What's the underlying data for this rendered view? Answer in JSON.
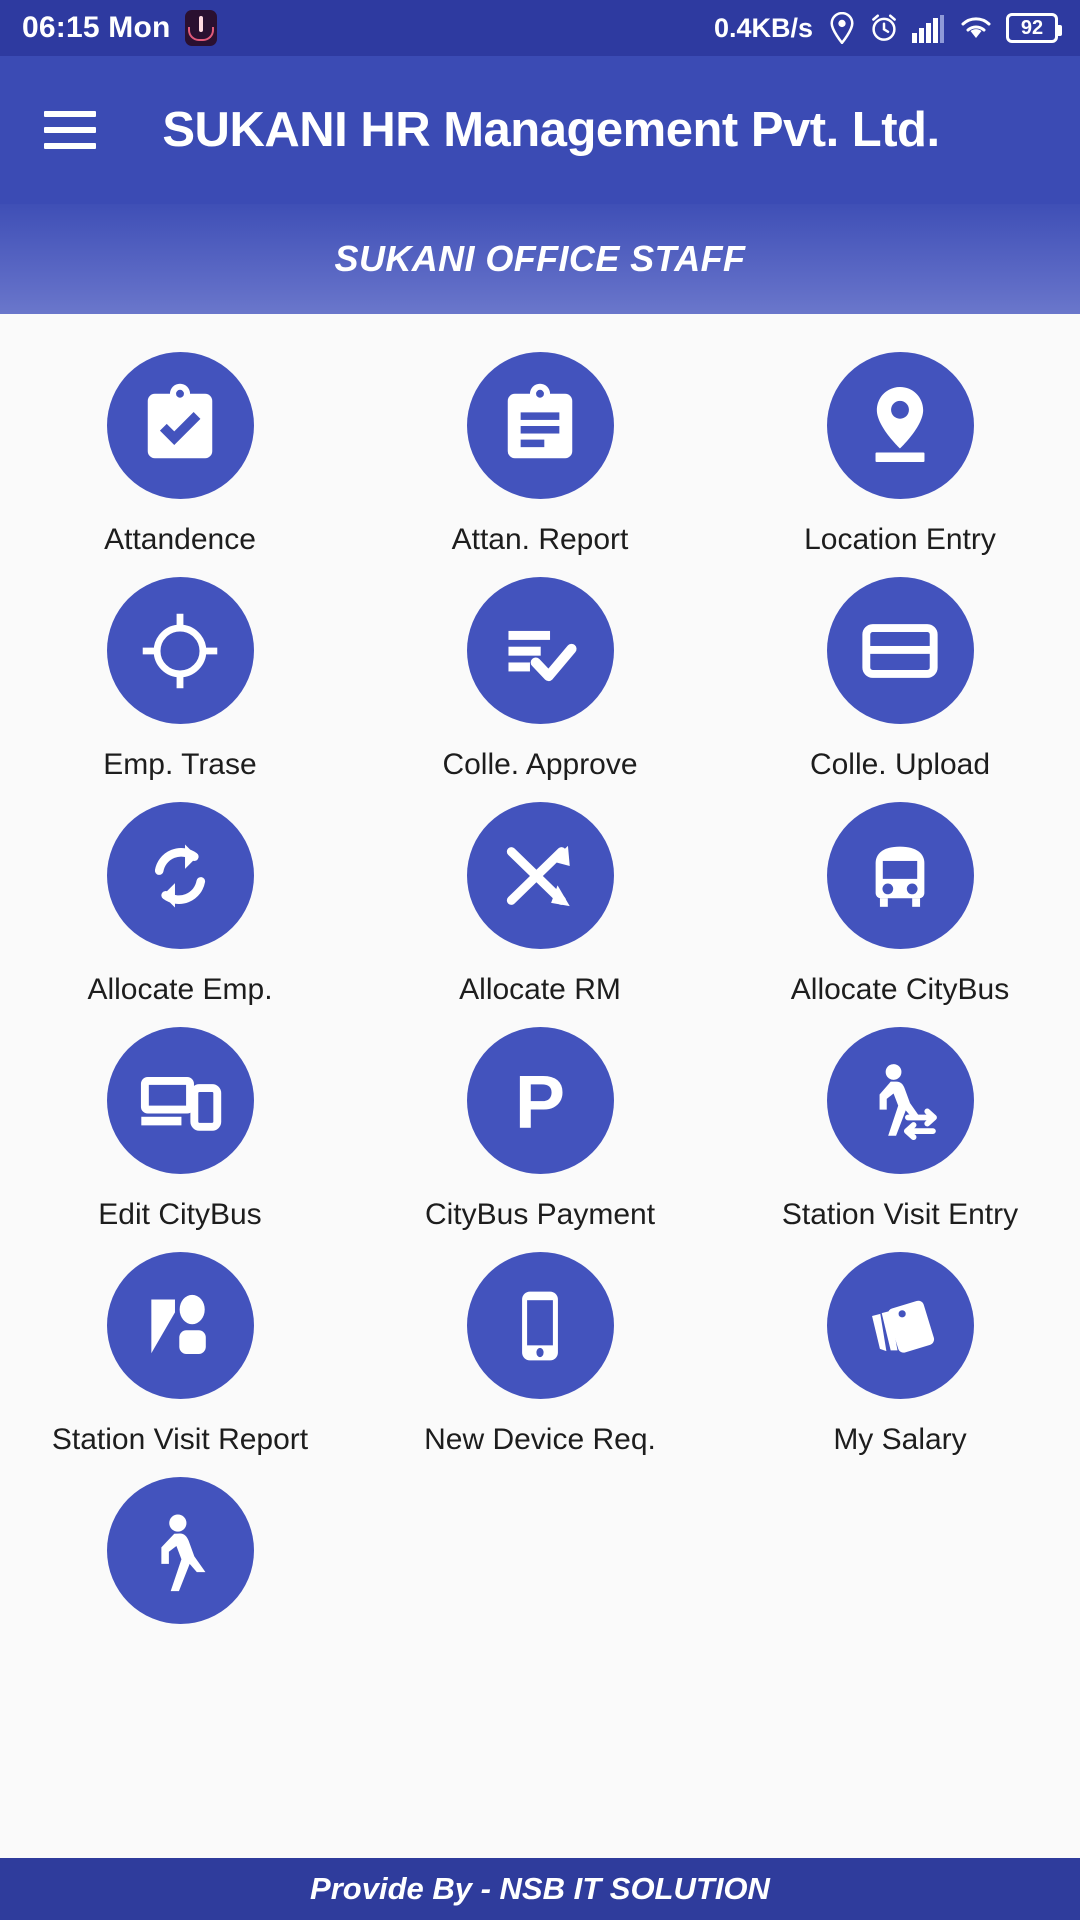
{
  "statusbar": {
    "time": "06:15 Mon",
    "app_icon": "rocket-app-icon",
    "network_speed": "0.4KB/s",
    "icons": [
      "location-pin-icon",
      "alarm-clock-icon",
      "signal-bars-icon",
      "wifi-icon"
    ],
    "battery_level": "92"
  },
  "appbar": {
    "menu_icon": "hamburger-menu-icon",
    "title": "SUKANI HR Management Pvt. Ltd."
  },
  "subtitle": {
    "text": "SUKANI OFFICE STAFF"
  },
  "colors": {
    "statusbar_bg": "#2e3aa0",
    "appbar_bg": "#3b4bb4",
    "subtitle_bg_top": "#3f4fb6",
    "subtitle_bg_bottom": "#6a77cb",
    "icon_circle": "#4353bd",
    "page_bg": "#fafafa",
    "bottombar_bg": "#2f3c9c",
    "label_text": "#1d1d1d",
    "icon_glyph": "#ffffff"
  },
  "grid": {
    "columns": 3,
    "tiles": [
      {
        "label": "Attandence",
        "icon": "clipboard-check-icon"
      },
      {
        "label": "Attan. Report",
        "icon": "clipboard-list-icon"
      },
      {
        "label": "Location Entry",
        "icon": "location-pin-icon"
      },
      {
        "label": "Emp. Trase",
        "icon": "crosshair-target-icon"
      },
      {
        "label": "Colle. Approve",
        "icon": "list-check-icon"
      },
      {
        "label": "Colle. Upload",
        "icon": "credit-card-icon"
      },
      {
        "label": "Allocate Emp.",
        "icon": "sync-arrows-icon"
      },
      {
        "label": "Allocate RM",
        "icon": "shuffle-arrows-icon"
      },
      {
        "label": "Allocate CityBus",
        "icon": "bus-icon"
      },
      {
        "label": "Edit CityBus",
        "icon": "devices-icon"
      },
      {
        "label": "CityBus Payment",
        "icon": "parking-p-icon"
      },
      {
        "label": "Station Visit Entry",
        "icon": "walking-person-transfer-icon"
      },
      {
        "label": "Station Visit Report",
        "icon": "person-report-icon"
      },
      {
        "label": "New Device Req.",
        "icon": "mobile-phone-icon"
      },
      {
        "label": "My Salary",
        "icon": "money-cards-icon"
      },
      {
        "label": "",
        "icon": "walking-person-icon"
      }
    ]
  },
  "bottombar": {
    "text": "Provide By - NSB IT SOLUTION"
  }
}
